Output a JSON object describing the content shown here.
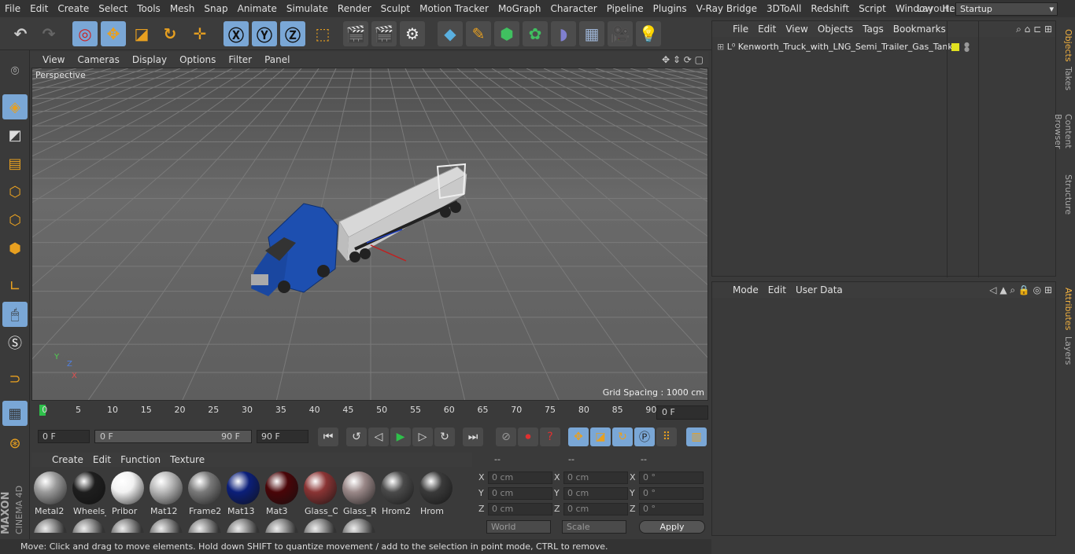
{
  "menubar": {
    "items": [
      "File",
      "Edit",
      "Create",
      "Select",
      "Tools",
      "Mesh",
      "Snap",
      "Animate",
      "Simulate",
      "Render",
      "Sculpt",
      "Motion Tracker",
      "MoGraph",
      "Character",
      "Pipeline",
      "Plugins",
      "V-Ray Bridge",
      "3DToAll",
      "Redshift",
      "Script",
      "Window",
      "Help"
    ],
    "layout_label": "Layout:",
    "layout_value": "Startup"
  },
  "viewport": {
    "menu": [
      "View",
      "Cameras",
      "Display",
      "Options",
      "Filter",
      "Panel"
    ],
    "label": "Perspective",
    "grid_spacing": "Grid Spacing : 1000 cm",
    "axis": {
      "x": "X",
      "y": "Y",
      "z": "Z"
    }
  },
  "timeline": {
    "ticks": [
      "0",
      "5",
      "10",
      "15",
      "20",
      "25",
      "30",
      "35",
      "40",
      "45",
      "50",
      "55",
      "60",
      "65",
      "70",
      "75",
      "80",
      "85",
      "90"
    ],
    "current_frame_right": "0 F",
    "start_field": "0 F",
    "range_start": "0 F",
    "range_end": "90 F",
    "end_field": "90 F"
  },
  "materials": {
    "menu": [
      "Create",
      "Edit",
      "Function",
      "Texture"
    ],
    "items": [
      {
        "name": "Metal2",
        "color": "#9a9a9a"
      },
      {
        "name": "Wheels_",
        "color": "#1e1e1e"
      },
      {
        "name": "Pribor",
        "color": "#f2f2f2"
      },
      {
        "name": "Mat12",
        "color": "#b8b8b8"
      },
      {
        "name": "Frame2",
        "color": "#7a7a7a"
      },
      {
        "name": "Mat13",
        "color": "#0b1f7a"
      },
      {
        "name": "Mat3",
        "color": "#4a0508"
      },
      {
        "name": "Glass_O",
        "color": "#8a3434"
      },
      {
        "name": "Glass_Re",
        "color": "#9a8888"
      },
      {
        "name": "Hrom2",
        "color": "#4a4a4a"
      },
      {
        "name": "Hrom",
        "color": "#3a3a3a"
      }
    ]
  },
  "coords": {
    "headers": [
      "--",
      "--",
      "--"
    ],
    "rows": [
      {
        "l1": "X",
        "v1": "0 cm",
        "l2": "X",
        "v2": "0 cm",
        "l3": "X",
        "v3": "0 °"
      },
      {
        "l1": "Y",
        "v1": "0 cm",
        "l2": "Y",
        "v2": "0 cm",
        "l3": "Y",
        "v3": "0 °"
      },
      {
        "l1": "Z",
        "v1": "0 cm",
        "l2": "Z",
        "v2": "0 cm",
        "l3": "Z",
        "v3": "0 °"
      }
    ],
    "mode": "World",
    "scale": "Scale",
    "apply": "Apply"
  },
  "objects": {
    "menu": [
      "File",
      "Edit",
      "View",
      "Objects",
      "Tags",
      "Bookmarks"
    ],
    "item": "Kenworth_Truck_with_LNG_Semi_Trailer_Gas_Tank"
  },
  "attributes": {
    "menu": [
      "Mode",
      "Edit",
      "User Data"
    ]
  },
  "side_tabs": {
    "objects": "Objects",
    "takes": "Takes",
    "content_browser": "Content Browser",
    "structure": "Structure",
    "attributes": "Attributes",
    "layers": "Layers"
  },
  "brand": {
    "maxon": "MAXON",
    "cinema": "CINEMA 4D"
  },
  "status": "Move: Click and drag to move elements. Hold down SHIFT to quantize movement / add to the selection in point mode, CTRL to remove."
}
